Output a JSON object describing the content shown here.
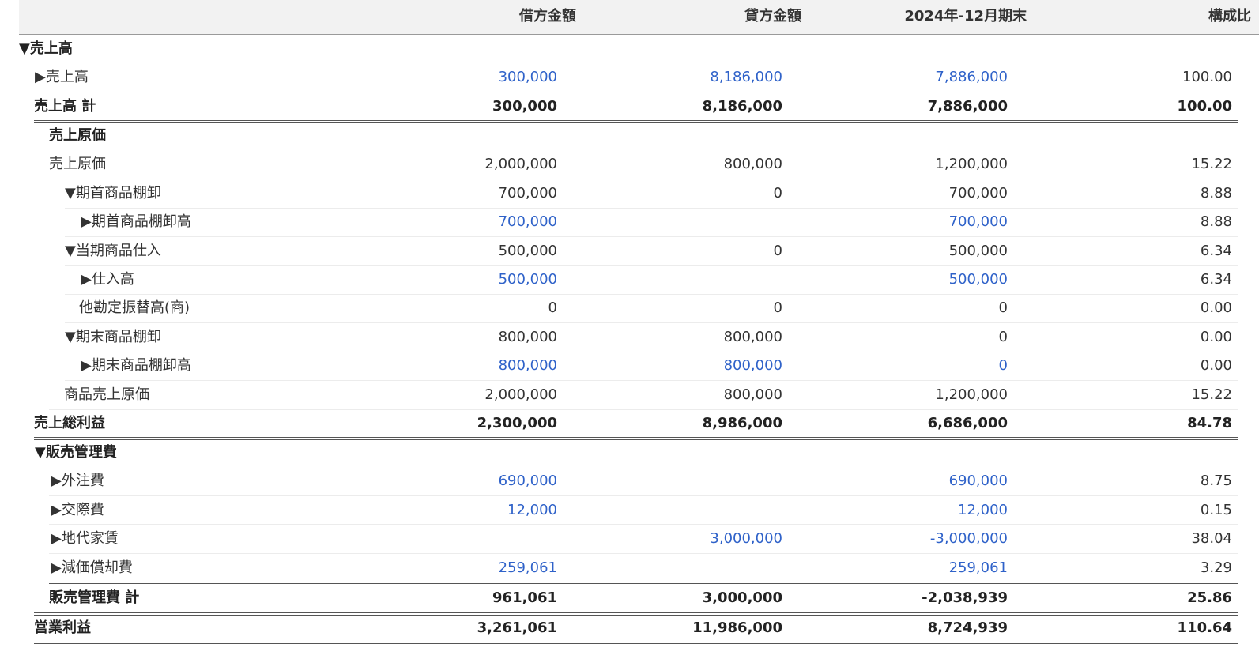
{
  "header": {
    "col_debit": "借方金額",
    "col_credit": "貸方金額",
    "col_balance": "2024年-12月期末",
    "col_ratio": "構成比"
  },
  "rows": [
    {
      "label": "▼売上高",
      "debit": "",
      "credit": "",
      "balance": "",
      "ratio": "",
      "style": "bold"
    },
    {
      "label": "▶売上高",
      "debit": "300,000",
      "credit": "8,186,000",
      "balance": "7,886,000",
      "ratio": "100.00",
      "style": "link"
    },
    {
      "label": "売上高 計",
      "debit": "300,000",
      "credit": "8,186,000",
      "balance": "7,886,000",
      "ratio": "100.00",
      "style": "bold"
    },
    {
      "label": "売上原価",
      "debit": "",
      "credit": "",
      "balance": "",
      "ratio": "",
      "style": "bold"
    },
    {
      "label": "売上原価",
      "debit": "2,000,000",
      "credit": "800,000",
      "balance": "1,200,000",
      "ratio": "15.22",
      "style": "plain"
    },
    {
      "label": "▼期首商品棚卸",
      "debit": "700,000",
      "credit": "0",
      "balance": "700,000",
      "ratio": "8.88",
      "style": "plain"
    },
    {
      "label": "▶期首商品棚卸高",
      "debit": "700,000",
      "credit": "",
      "balance": "700,000",
      "ratio": "8.88",
      "style": "link"
    },
    {
      "label": "▼当期商品仕入",
      "debit": "500,000",
      "credit": "0",
      "balance": "500,000",
      "ratio": "6.34",
      "style": "plain"
    },
    {
      "label": "▶仕入高",
      "debit": "500,000",
      "credit": "",
      "balance": "500,000",
      "ratio": "6.34",
      "style": "link"
    },
    {
      "label": "他勘定振替高(商)",
      "debit": "0",
      "credit": "0",
      "balance": "0",
      "ratio": "0.00",
      "style": "plain"
    },
    {
      "label": "▼期末商品棚卸",
      "debit": "800,000",
      "credit": "800,000",
      "balance": "0",
      "ratio": "0.00",
      "style": "plain"
    },
    {
      "label": "▶期末商品棚卸高",
      "debit": "800,000",
      "credit": "800,000",
      "balance": "0",
      "ratio": "0.00",
      "style": "link"
    },
    {
      "label": "商品売上原価",
      "debit": "2,000,000",
      "credit": "800,000",
      "balance": "1,200,000",
      "ratio": "15.22",
      "style": "plain"
    },
    {
      "label": "売上総利益",
      "debit": "2,300,000",
      "credit": "8,986,000",
      "balance": "6,686,000",
      "ratio": "84.78",
      "style": "bold"
    },
    {
      "label": "▼販売管理費",
      "debit": "",
      "credit": "",
      "balance": "",
      "ratio": "",
      "style": "bold"
    },
    {
      "label": "▶外注費",
      "debit": "690,000",
      "credit": "",
      "balance": "690,000",
      "ratio": "8.75",
      "style": "link"
    },
    {
      "label": "▶交際費",
      "debit": "12,000",
      "credit": "",
      "balance": "12,000",
      "ratio": "0.15",
      "style": "link"
    },
    {
      "label": "▶地代家賃",
      "debit": "",
      "credit": "3,000,000",
      "balance": "-3,000,000",
      "ratio": "38.04",
      "style": "link"
    },
    {
      "label": "▶減価償却費",
      "debit": "259,061",
      "credit": "",
      "balance": "259,061",
      "ratio": "3.29",
      "style": "link"
    },
    {
      "label": "販売管理費 計",
      "debit": "961,061",
      "credit": "3,000,000",
      "balance": "-2,038,939",
      "ratio": "25.86",
      "style": "bold"
    },
    {
      "label": "営業利益",
      "debit": "3,261,061",
      "credit": "11,986,000",
      "balance": "8,724,939",
      "ratio": "110.64",
      "style": "bold"
    }
  ],
  "colors": {
    "link": "#2f62c9",
    "text": "#333333",
    "header_bg": "#f2f2f2"
  }
}
